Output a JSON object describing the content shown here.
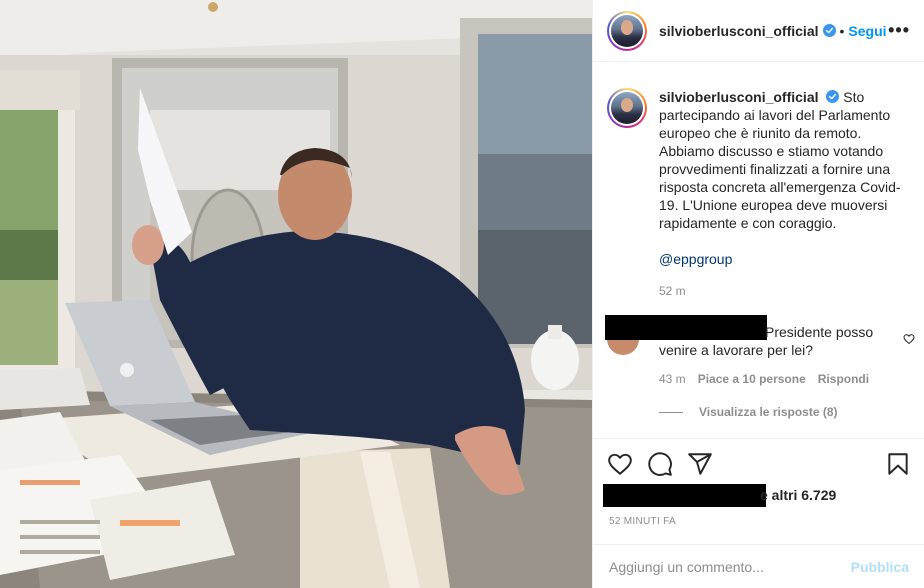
{
  "post": {
    "username": "silvioberlusconi_official",
    "follow_label": "Segui",
    "separator": "•",
    "more_label": "•••"
  },
  "caption": {
    "username": "silvioberlusconi_official",
    "text": "Sto partecipando ai lavori del Parlamento europeo che è riunito da remoto. Abbiamo discusso e stiamo votando provvedimenti finalizzati a fornire una risposta concreta all'emergenza Covid-19. L'Unione europea deve muoversi rapidamente e con coraggio.",
    "mention": "@eppgroup",
    "time": "52 m"
  },
  "comment": {
    "text": "Presidente posso venire a lavorare per lei?",
    "time": "43 m",
    "likes_label": "Piace a 10 persone",
    "reply_label": "Rispondi",
    "view_replies": "Visualizza le risposte (8)"
  },
  "likes": {
    "text": "e altri 6.729"
  },
  "date": "52 minuti fa",
  "add_comment": {
    "placeholder": "Aggiungi un commento...",
    "publish_label": "Pubblica"
  },
  "colors": {
    "link_blue": "#0095f6",
    "publish_disabled": "#b2dffc",
    "muted": "#8e8e8e"
  },
  "icons": {
    "verified": "verified-badge-icon",
    "heart": "heart-icon",
    "comment": "comment-icon",
    "share": "paper-plane-icon",
    "save": "bookmark-icon"
  }
}
